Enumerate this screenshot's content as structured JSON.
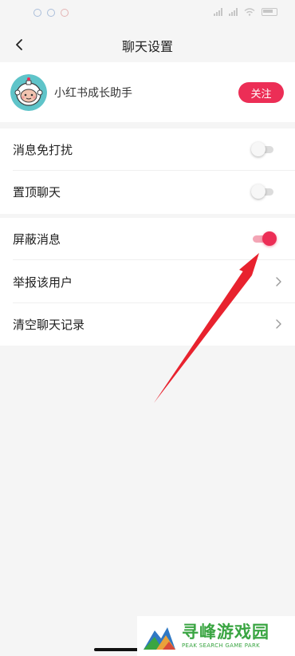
{
  "header": {
    "title": "聊天设置",
    "back_icon": "chevron-left-icon"
  },
  "user": {
    "name": "小红书成长助手",
    "follow_label": "关注",
    "avatar_icon": "astronaut-avatar"
  },
  "settings": {
    "group1": [
      {
        "label": "消息免打扰",
        "control": "toggle",
        "on": false
      },
      {
        "label": "置顶聊天",
        "control": "toggle",
        "on": false
      }
    ],
    "group2": [
      {
        "label": "屏蔽消息",
        "control": "toggle",
        "on": true
      },
      {
        "label": "举报该用户",
        "control": "chevron"
      },
      {
        "label": "清空聊天记录",
        "control": "chevron"
      }
    ]
  },
  "annotation": {
    "type": "red-arrow",
    "color": "#e8222e",
    "points_to": "屏蔽消息 toggle"
  },
  "watermark": {
    "title": "寻峰游戏园",
    "subtitle": "PEAK SEARCH GAME PARK"
  },
  "colors": {
    "accent": "#ec2e56",
    "background": "#f5f5f5",
    "card": "#ffffff"
  }
}
